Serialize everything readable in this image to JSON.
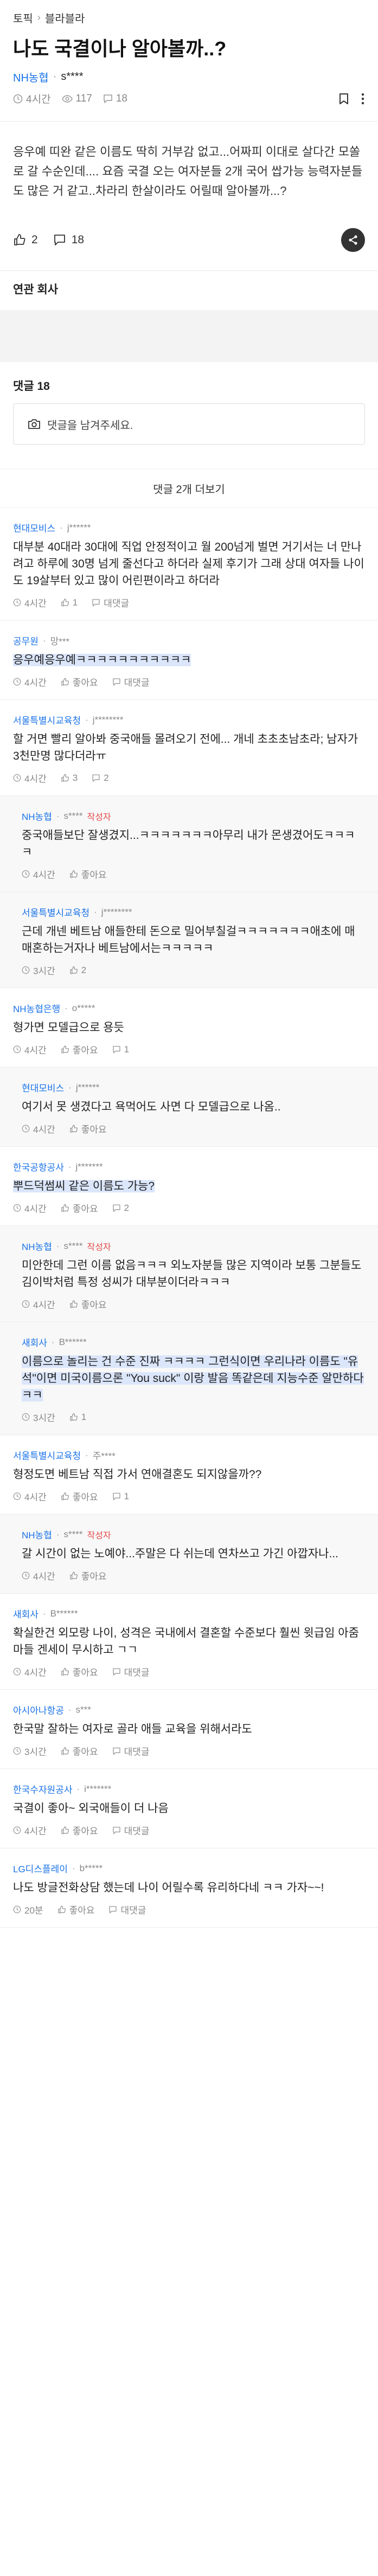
{
  "breadcrumb": {
    "topic": "토픽",
    "separator": "›",
    "board": "블라블라"
  },
  "post": {
    "title": "나도 국결이나 알아볼까..?",
    "company": "NH농협",
    "author": "s****",
    "time": "4시간",
    "views": "117",
    "comment_count": "18",
    "body": "응우예 띠완 같은 이름도 딱히 거부감 없고...어짜피 이대로 살다간 모쏠로 갈 수순인데.... 요즘 국결 오는 여자분들 2개 국어 쌉가능 능력자분들도 많은 거 같고..차라리 한살이라도 어릴때 알아볼까...?",
    "likes": "2",
    "comments_total": "18"
  },
  "related": {
    "title": "연관 회사"
  },
  "comments_section": {
    "title": "댓글 18",
    "input_placeholder": "댓글을 남겨주세요.",
    "more_label": "댓글 2개 더보기"
  },
  "icons": {
    "time": "clock-icon",
    "views": "eye-icon",
    "comments": "speech-bubble-icon",
    "bookmark": "bookmark-icon",
    "more": "more-dots-icon",
    "like": "thumbs-up-icon",
    "share": "share-icon",
    "camera": "camera-icon",
    "reply": "reply-icon"
  },
  "colors": {
    "company": "#1a73e8",
    "badge": "#e34a4a",
    "highlight": "#dbe6fb"
  },
  "comments": [
    {
      "company": "현대모비스",
      "author": "j******",
      "badge": "",
      "text": "대부분 40대라 30대에 직업 안정적이고 월 200넘게 벌면 거기서는 너 만나려고 하루에 30명 넘게 줄선다고 하더라 실제 후기가 그래 상대 여자들 나이도 19살부터 있고 많이 어린편이라고 하더라",
      "time": "4시간",
      "likes": "1",
      "reply": "대댓글",
      "highlight": false,
      "is_reply": false
    },
    {
      "company": "공무원",
      "author": "망***",
      "badge": "",
      "text": "응우예응우예ㅋㅋㅋㅋㅋㅋㅋㅋㅋㅋㅋ",
      "time": "4시간",
      "likes": "좋아요",
      "reply": "대댓글",
      "highlight": true,
      "is_reply": false
    },
    {
      "company": "서울특별시교육청",
      "author": "j********",
      "badge": "",
      "text": "할 거면 빨리 알아봐 중국애들 몰려오기 전에... 개네 초초초남초라; 남자가 3천만명 많다더라ㅠ",
      "time": "4시간",
      "likes": "3",
      "reply": "2",
      "highlight": false,
      "is_reply": false
    },
    {
      "company": "NH농협",
      "author": "s****",
      "badge": "작성자",
      "text": "중국애들보단 잘생겼지...ㅋㅋㅋㅋㅋㅋㅋ아무리 내가 몬생겼어도ㅋㅋㅋㅋ",
      "time": "4시간",
      "likes": "좋아요",
      "reply": "",
      "highlight": false,
      "is_reply": true
    },
    {
      "company": "서울특별시교육청",
      "author": "j********",
      "badge": "",
      "text": "근데 개넨 베트남 애들한테 돈으로 밀어부칠걸ㅋㅋㅋㅋㅋㅋㅋ애초에 매매혼하는거자나 베트남에서는ㅋㅋㅋㅋㅋ",
      "time": "3시간",
      "likes": "2",
      "reply": "",
      "highlight": false,
      "is_reply": true
    },
    {
      "company": "NH농협은행",
      "author": "o*****",
      "badge": "",
      "text": "형가면 모델급으로 용듯",
      "time": "4시간",
      "likes": "좋아요",
      "reply": "1",
      "highlight": false,
      "is_reply": false
    },
    {
      "company": "현대모비스",
      "author": "j******",
      "badge": "",
      "text": "여기서 못 생겼다고 욕먹어도 사면 다 모델급으로 나옴..",
      "time": "4시간",
      "likes": "좋아요",
      "reply": "",
      "highlight": false,
      "is_reply": true
    },
    {
      "company": "한국공항공사",
      "author": "j*******",
      "badge": "",
      "text": "뿌드덕썸씨 같은 이름도 가능?",
      "time": "4시간",
      "likes": "좋아요",
      "reply": "2",
      "highlight": true,
      "is_reply": false
    },
    {
      "company": "NH농협",
      "author": "s****",
      "badge": "작성자",
      "text": "미안한데 그런 이름 없음ㅋㅋㅋ 외노자분들 많은 지역이라 보통 그분들도 김이박처럼 특정 성씨가 대부분이더라ㅋㅋㅋ",
      "time": "4시간",
      "likes": "좋아요",
      "reply": "",
      "highlight": false,
      "is_reply": true
    },
    {
      "company": "새회사",
      "author": "B******",
      "badge": "",
      "text": "이름으로 놀리는 건 수준 진짜 ㅋㅋㅋㅋ 그런식이면 우리나라 이름도 \"유석\"이면 미국이름으론 \"You suck\" 이랑 발음 똑같은데 지능수준 알만하다 ㅋㅋ",
      "time": "3시간",
      "likes": "1",
      "reply": "",
      "highlight": true,
      "is_reply": true
    },
    {
      "company": "서울특별시교육청",
      "author": "주****",
      "badge": "",
      "text": "형정도면 베트남 직접 가서 연애결혼도 되지않을까??",
      "time": "4시간",
      "likes": "좋아요",
      "reply": "1",
      "highlight": false,
      "is_reply": false
    },
    {
      "company": "NH농협",
      "author": "s****",
      "badge": "작성자",
      "text": "갈 시간이 없는 노예야...주말은 다 쉬는데 연차쓰고 가긴 아깝자나...",
      "time": "4시간",
      "likes": "좋아요",
      "reply": "",
      "highlight": false,
      "is_reply": true
    },
    {
      "company": "새회사",
      "author": "B******",
      "badge": "",
      "text": "확실한건 외모랑 나이, 성격은 국내에서 결혼할 수준보다 훨씬 윗급임 아줌마들 겐세이 무시하고 ㄱㄱ",
      "time": "4시간",
      "likes": "좋아요",
      "reply": "대댓글",
      "highlight": false,
      "is_reply": false
    },
    {
      "company": "아시아나항공",
      "author": "s***",
      "badge": "",
      "text": "한국말 잘하는 여자로 골라 애들 교육을 위해서라도",
      "time": "3시간",
      "likes": "좋아요",
      "reply": "대댓글",
      "highlight": false,
      "is_reply": false
    },
    {
      "company": "한국수자원공사",
      "author": "i*******",
      "badge": "",
      "text": "국결이 좋아~ 외국애들이 더 나음",
      "time": "4시간",
      "likes": "좋아요",
      "reply": "대댓글",
      "highlight": false,
      "is_reply": false
    },
    {
      "company": "LG디스플레이",
      "author": "b*****",
      "badge": "",
      "text": "나도 방글전화상담 했는데 나이 어릴수록 유리하다네 ㅋㅋ 가자~~!",
      "time": "20분",
      "likes": "좋아요",
      "reply": "대댓글",
      "highlight": false,
      "is_reply": false
    }
  ]
}
